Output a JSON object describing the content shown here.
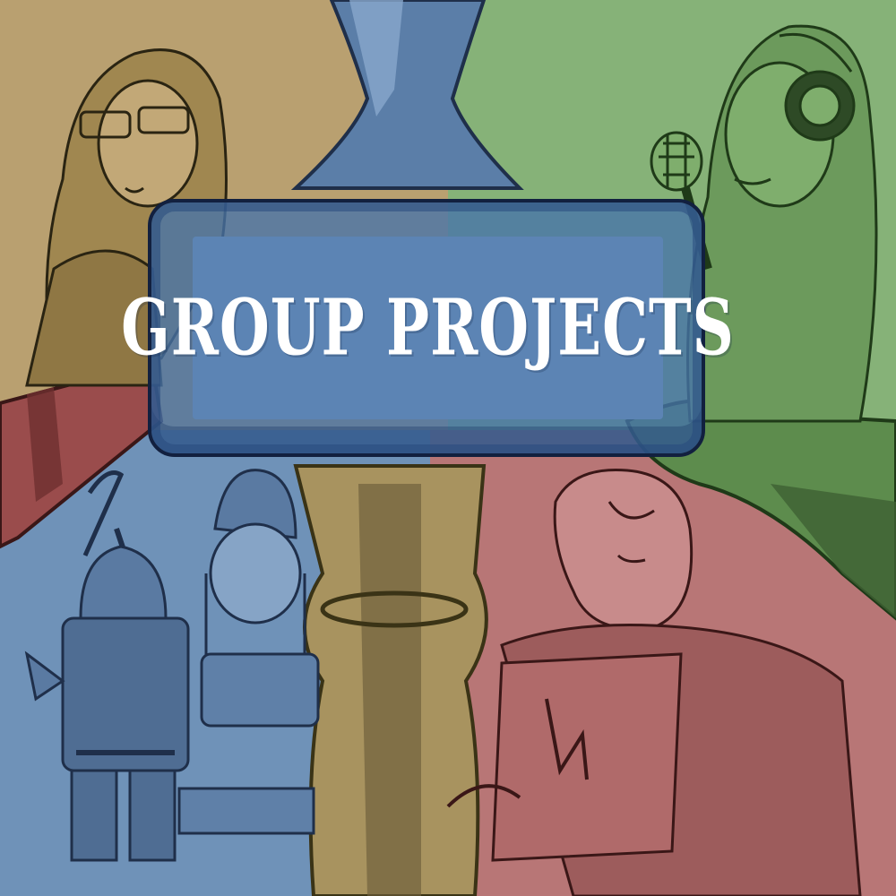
{
  "title": "GROUP PROJECTS",
  "colors": {
    "tan_quadrant": "#b9a070",
    "green_quadrant": "#86b278",
    "blue_quadrant": "#6f92b8",
    "red_quadrant": "#b87676",
    "sign_fill": "#5c84b4",
    "sign_border": "#12203f",
    "title_text": "#ffffff"
  },
  "characters": [
    {
      "name": "glasses-character",
      "quadrant": "top-left"
    },
    {
      "name": "headphones-singer-character",
      "quadrant": "top-right"
    },
    {
      "name": "armored-dwarf-character",
      "quadrant": "bottom-left"
    },
    {
      "name": "beanie-character",
      "quadrant": "bottom-left"
    },
    {
      "name": "laptop-character",
      "quadrant": "bottom-right"
    }
  ]
}
